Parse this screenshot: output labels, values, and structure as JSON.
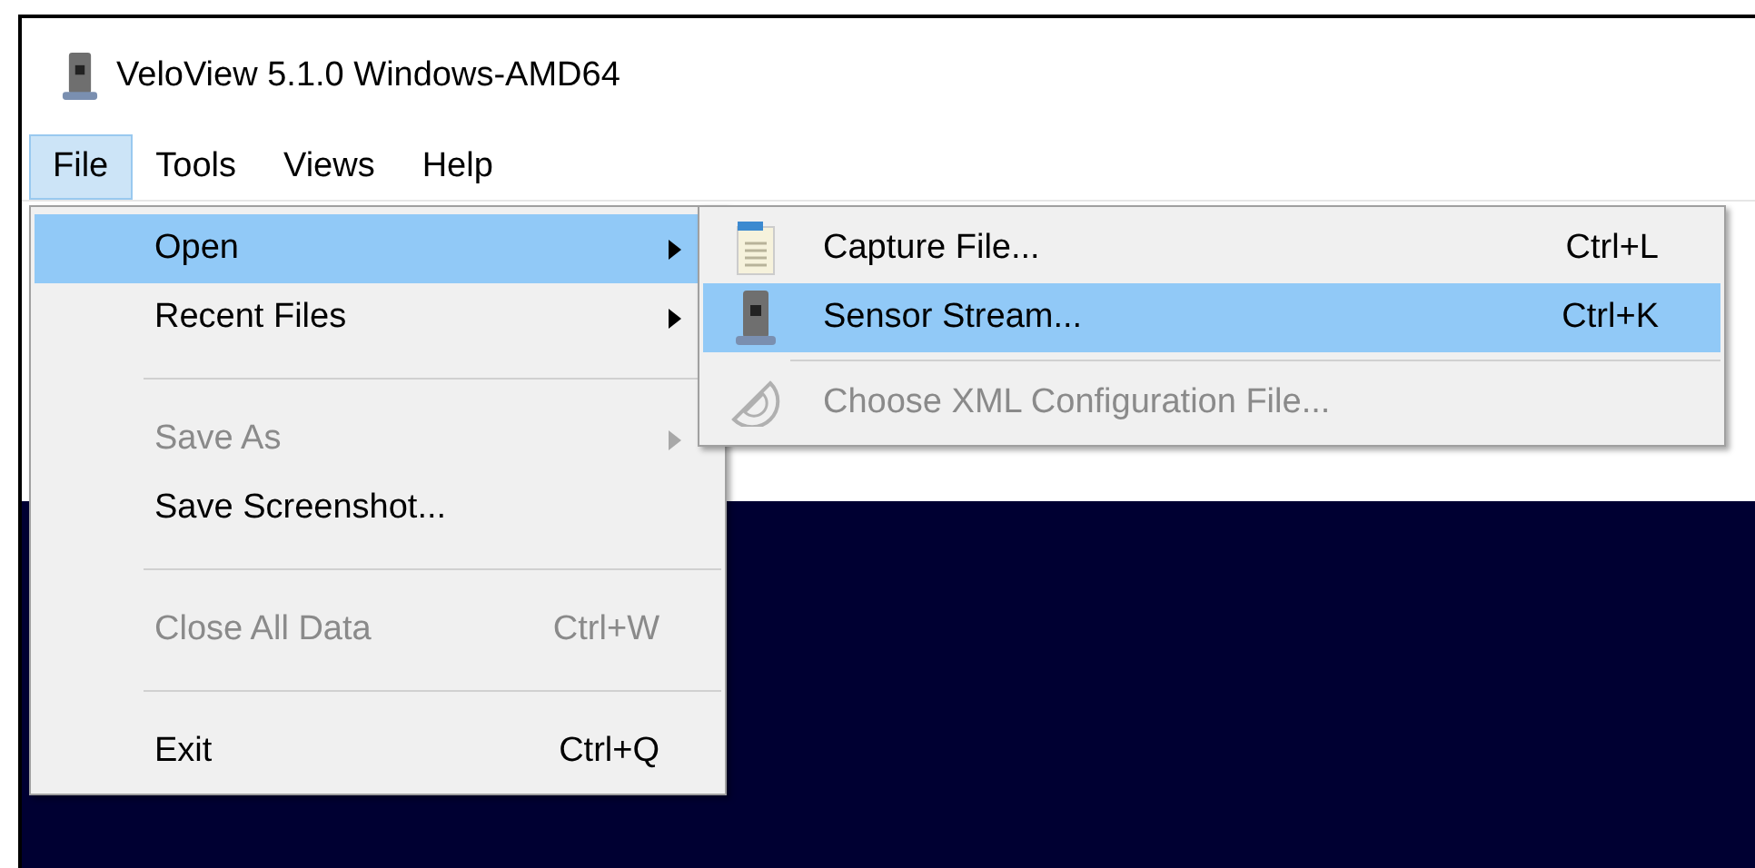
{
  "window": {
    "title": "VeloView 5.1.0 Windows-AMD64"
  },
  "menubar": [
    {
      "label": "File",
      "selected": true
    },
    {
      "label": "Tools",
      "selected": false
    },
    {
      "label": "Views",
      "selected": false
    },
    {
      "label": "Help",
      "selected": false
    }
  ],
  "file_menu": [
    {
      "kind": "item",
      "label": "Open",
      "submenu": true,
      "selected": true,
      "disabled": false
    },
    {
      "kind": "item",
      "label": "Recent Files",
      "submenu": true,
      "selected": false,
      "disabled": false
    },
    {
      "kind": "separator"
    },
    {
      "kind": "item",
      "label": "Save As",
      "submenu": true,
      "selected": false,
      "disabled": true
    },
    {
      "kind": "item",
      "label": "Save Screenshot...",
      "submenu": false,
      "selected": false,
      "disabled": false
    },
    {
      "kind": "separator"
    },
    {
      "kind": "item",
      "label": "Close All Data",
      "shortcut": "Ctrl+W",
      "submenu": false,
      "selected": false,
      "disabled": true
    },
    {
      "kind": "separator"
    },
    {
      "kind": "item",
      "label": "Exit",
      "shortcut": "Ctrl+Q",
      "submenu": false,
      "selected": false,
      "disabled": false
    }
  ],
  "open_submenu": [
    {
      "kind": "item",
      "label": "Capture File...",
      "shortcut": "Ctrl+L",
      "selected": false,
      "disabled": false
    },
    {
      "kind": "item",
      "label": "Sensor Stream...",
      "shortcut": "Ctrl+K",
      "selected": true,
      "disabled": false
    },
    {
      "kind": "separator"
    },
    {
      "kind": "item",
      "label": "Choose XML Configuration File...",
      "selected": false,
      "disabled": true
    }
  ]
}
